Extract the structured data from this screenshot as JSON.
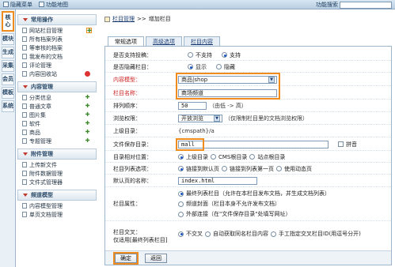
{
  "topbar": {
    "hide_menu": "隐藏菜单",
    "site_map": "功能地图",
    "search_label": "功能搜索"
  },
  "left_tabs": [
    "核心",
    "模块",
    "生成",
    "采集",
    "会员",
    "模板",
    "系统"
  ],
  "menu": {
    "groups": [
      {
        "title": "常用操作",
        "items": [
          {
            "label": "网站栏目管理",
            "action": "plus",
            "highlight": true
          },
          {
            "label": "所有档案列表",
            "action": ""
          },
          {
            "label": "等审核的档案",
            "action": ""
          },
          {
            "label": "我发布的文档",
            "action": ""
          },
          {
            "label": "评论管理",
            "action": ""
          },
          {
            "label": "内容回收站",
            "action": "delete"
          }
        ]
      },
      {
        "title": "内容管理",
        "items": [
          {
            "label": "分类信息",
            "action": "plus"
          },
          {
            "label": "普通文章",
            "action": "plus"
          },
          {
            "label": "图片集",
            "action": "plus"
          },
          {
            "label": "软件",
            "action": "plus"
          },
          {
            "label": "商品",
            "action": "plus"
          },
          {
            "label": "专题管理",
            "action": "plus"
          }
        ]
      },
      {
        "title": "附件管理",
        "items": [
          {
            "label": "上传新文件",
            "action": ""
          },
          {
            "label": "附件数据管理",
            "action": ""
          },
          {
            "label": "文件式管理器",
            "action": ""
          }
        ]
      },
      {
        "title": "频道模型",
        "items": [
          {
            "label": "内容模型管理",
            "action": ""
          },
          {
            "label": "单页文档管理",
            "action": ""
          }
        ]
      }
    ]
  },
  "breadcrumb": {
    "link": "栏目管理",
    "sep": ">>",
    "current": "增加栏目"
  },
  "tabs": [
    "常规选项",
    "高级选项",
    "栏目内容"
  ],
  "form": {
    "support_submit": {
      "label": "是否支持投稿：",
      "opt1": "不支持",
      "opt2": "支持"
    },
    "hidden": {
      "label": "是否隐藏栏目：",
      "opt1": "显示",
      "opt2": "隐藏"
    },
    "model": {
      "label": "内容模型：",
      "value": "商品|shop"
    },
    "name": {
      "label": "栏目名称：",
      "value": "商场频道"
    },
    "order": {
      "label": "排列顺序：",
      "value": "50",
      "hint": "（由低 -> 高）"
    },
    "browse": {
      "label": "浏览权限：",
      "value": "开放浏览",
      "hint": "（仅限制栏目里的文档浏览权限）"
    },
    "parent_dir": {
      "label": "上级目录：",
      "value": "{cmspath}/a"
    },
    "save_dir": {
      "label": "文件保存目录：",
      "value": "mall",
      "pinyin": "拼音"
    },
    "root_pos": {
      "label": "目录相对位置：",
      "opt1": "上级目录",
      "opt2": "CMS根目录",
      "opt3": "站点根目录"
    },
    "list_opt": {
      "label": "栏目列表选项：",
      "opt1": "链接到默认页",
      "opt2": "链接到列表第一页",
      "opt3": "使用动态页"
    },
    "default_page": {
      "label": "默认页的名称：",
      "value": "index.html"
    },
    "attr": {
      "label": "栏目属性：",
      "opt1": "最终列表栏目（允许在本栏目发布文档，并生成文档列表）",
      "opt2": "频道封面（栏目本身不允许发布文档）",
      "opt3": "外部连接（在\"文件保存目录\"处填写网址）"
    },
    "cross": {
      "label": "栏目交叉：",
      "sub": "仅适用[最终列表栏目]",
      "opt1": "不交叉",
      "opt2": "自动获取同名栏目内容",
      "opt3": "手工指定交叉栏目ID(用逗号分开)"
    }
  },
  "buttons": {
    "ok": "确定",
    "back": "返回"
  },
  "colors": {
    "highlight": "#f08c1e",
    "required_label": "#cc1f1f",
    "link": "#1d3f75"
  }
}
